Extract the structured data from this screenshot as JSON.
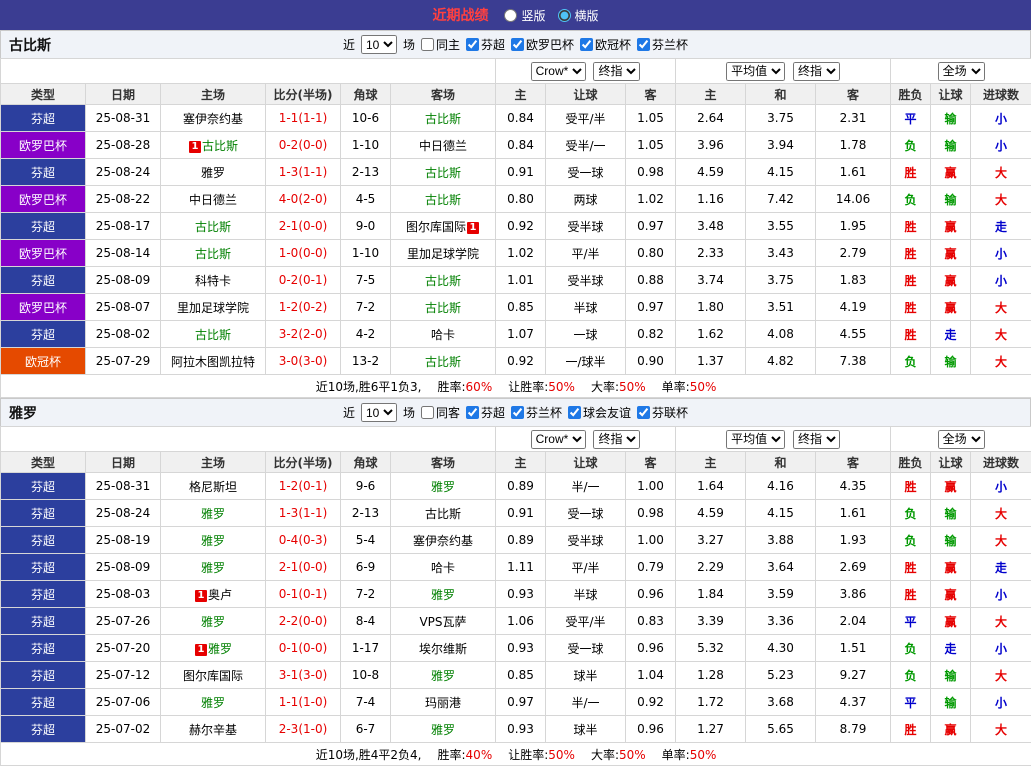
{
  "titlebar": {
    "title": "近期战绩",
    "options": [
      {
        "label": "竖版",
        "selected": false
      },
      {
        "label": "横版",
        "selected": true
      }
    ]
  },
  "colors": {
    "titlebar_bg": "#3b3d92",
    "title_text": "#ff4040",
    "focal_team": "#008000",
    "score_text": "#e60000",
    "badge_bg": "#e60000",
    "checkbox_accent": "#1e78e6",
    "summary_value": "#e60000",
    "result_red": "#e60000",
    "result_green": "#009900",
    "result_blue": "#0000cc"
  },
  "league_colors": {
    "芬超": "#2c3f9e",
    "欧罗巴杯": "#8800c8",
    "欧冠杯": "#e54a00"
  },
  "header": {
    "cols": [
      "类型",
      "日期",
      "主场",
      "比分(半场)",
      "角球",
      "客场",
      "主",
      "让球",
      "客",
      "主",
      "和",
      "客",
      "胜负",
      "让球",
      "进球数"
    ],
    "group1": {
      "select1": "Crow*",
      "select2": "终指"
    },
    "group2": {
      "select1": "平均值",
      "select2": "终指"
    },
    "group3": {
      "select1": "全场"
    }
  },
  "sections": [
    {
      "team": "古比斯",
      "filter": {
        "near_label": "近",
        "count": "10",
        "games_label": "场",
        "same_label": "同主",
        "leagues": [
          "芬超",
          "欧罗巴杯",
          "欧冠杯",
          "芬兰杯"
        ]
      },
      "rows": [
        {
          "league": "芬超",
          "date": "25-08-31",
          "home": {
            "name": "塞伊奈约基",
            "focal": false
          },
          "score": "1-1(1-1)",
          "corners": "10-6",
          "away": {
            "name": "古比斯",
            "focal": true
          },
          "ah": [
            "0.84",
            "受平/半",
            "1.05"
          ],
          "avg": [
            "2.64",
            "3.75",
            "2.31"
          ],
          "results": [
            "平",
            "输",
            "小"
          ]
        },
        {
          "league": "欧罗巴杯",
          "date": "25-08-28",
          "home": {
            "name": "古比斯",
            "focal": true,
            "badge": "1",
            "badge_pos": "pre"
          },
          "score": "0-2(0-0)",
          "corners": "1-10",
          "away": {
            "name": "中日德兰",
            "focal": false
          },
          "ah": [
            "0.84",
            "受半/一",
            "1.05"
          ],
          "avg": [
            "3.96",
            "3.94",
            "1.78"
          ],
          "results": [
            "负",
            "输",
            "小"
          ]
        },
        {
          "league": "芬超",
          "date": "25-08-24",
          "home": {
            "name": "雅罗",
            "focal": false
          },
          "score": "1-3(1-1)",
          "corners": "2-13",
          "away": {
            "name": "古比斯",
            "focal": true
          },
          "ah": [
            "0.91",
            "受一球",
            "0.98"
          ],
          "avg": [
            "4.59",
            "4.15",
            "1.61"
          ],
          "results": [
            "胜",
            "赢",
            "大"
          ]
        },
        {
          "league": "欧罗巴杯",
          "date": "25-08-22",
          "home": {
            "name": "中日德兰",
            "focal": false
          },
          "score": "4-0(2-0)",
          "corners": "4-5",
          "away": {
            "name": "古比斯",
            "focal": true
          },
          "ah": [
            "0.80",
            "两球",
            "1.02"
          ],
          "avg": [
            "1.16",
            "7.42",
            "14.06"
          ],
          "results": [
            "负",
            "输",
            "大"
          ]
        },
        {
          "league": "芬超",
          "date": "25-08-17",
          "home": {
            "name": "古比斯",
            "focal": true
          },
          "score": "2-1(0-0)",
          "corners": "9-0",
          "away": {
            "name": "图尔库国际",
            "focal": false,
            "badge": "1",
            "badge_pos": "post"
          },
          "ah": [
            "0.92",
            "受半球",
            "0.97"
          ],
          "avg": [
            "3.48",
            "3.55",
            "1.95"
          ],
          "results": [
            "胜",
            "赢",
            "走"
          ]
        },
        {
          "league": "欧罗巴杯",
          "date": "25-08-14",
          "home": {
            "name": "古比斯",
            "focal": true
          },
          "score": "1-0(0-0)",
          "corners": "1-10",
          "away": {
            "name": "里加足球学院",
            "focal": false
          },
          "ah": [
            "1.02",
            "平/半",
            "0.80"
          ],
          "avg": [
            "2.33",
            "3.43",
            "2.79"
          ],
          "results": [
            "胜",
            "赢",
            "小"
          ]
        },
        {
          "league": "芬超",
          "date": "25-08-09",
          "home": {
            "name": "科特卡",
            "focal": false
          },
          "score": "0-2(0-1)",
          "corners": "7-5",
          "away": {
            "name": "古比斯",
            "focal": true
          },
          "ah": [
            "1.01",
            "受半球",
            "0.88"
          ],
          "avg": [
            "3.74",
            "3.75",
            "1.83"
          ],
          "results": [
            "胜",
            "赢",
            "小"
          ]
        },
        {
          "league": "欧罗巴杯",
          "date": "25-08-07",
          "home": {
            "name": "里加足球学院",
            "focal": false
          },
          "score": "1-2(0-2)",
          "corners": "7-2",
          "away": {
            "name": "古比斯",
            "focal": true
          },
          "ah": [
            "0.85",
            "半球",
            "0.97"
          ],
          "avg": [
            "1.80",
            "3.51",
            "4.19"
          ],
          "results": [
            "胜",
            "赢",
            "大"
          ]
        },
        {
          "league": "芬超",
          "date": "25-08-02",
          "home": {
            "name": "古比斯",
            "focal": true
          },
          "score": "3-2(2-0)",
          "corners": "4-2",
          "away": {
            "name": "哈卡",
            "focal": false
          },
          "ah": [
            "1.07",
            "一球",
            "0.82"
          ],
          "avg": [
            "1.62",
            "4.08",
            "4.55"
          ],
          "results": [
            "胜",
            "走",
            "大"
          ]
        },
        {
          "league": "欧冠杯",
          "date": "25-07-29",
          "home": {
            "name": "阿拉木图凯拉特",
            "focal": false
          },
          "score": "3-0(3-0)",
          "corners": "13-2",
          "away": {
            "name": "古比斯",
            "focal": true
          },
          "ah": [
            "0.92",
            "一/球半",
            "0.90"
          ],
          "avg": [
            "1.37",
            "4.82",
            "7.38"
          ],
          "results": [
            "负",
            "输",
            "大"
          ]
        }
      ],
      "summary": {
        "prefix": "近10场,胜6平1负3,",
        "stats": [
          {
            "label": "胜率:",
            "value": "60%"
          },
          {
            "label": "让胜率:",
            "value": "50%"
          },
          {
            "label": "大率:",
            "value": "50%"
          },
          {
            "label": "单率:",
            "value": "50%"
          }
        ]
      }
    },
    {
      "team": "雅罗",
      "filter": {
        "near_label": "近",
        "count": "10",
        "games_label": "场",
        "same_label": "同客",
        "leagues": [
          "芬超",
          "芬兰杯",
          "球会友谊",
          "芬联杯"
        ]
      },
      "rows": [
        {
          "league": "芬超",
          "date": "25-08-31",
          "home": {
            "name": "格尼斯坦",
            "focal": false
          },
          "score": "1-2(0-1)",
          "corners": "9-6",
          "away": {
            "name": "雅罗",
            "focal": true
          },
          "ah": [
            "0.89",
            "半/一",
            "1.00"
          ],
          "avg": [
            "1.64",
            "4.16",
            "4.35"
          ],
          "results": [
            "胜",
            "赢",
            "小"
          ]
        },
        {
          "league": "芬超",
          "date": "25-08-24",
          "home": {
            "name": "雅罗",
            "focal": true
          },
          "score": "1-3(1-1)",
          "corners": "2-13",
          "away": {
            "name": "古比斯",
            "focal": false
          },
          "ah": [
            "0.91",
            "受一球",
            "0.98"
          ],
          "avg": [
            "4.59",
            "4.15",
            "1.61"
          ],
          "results": [
            "负",
            "输",
            "大"
          ]
        },
        {
          "league": "芬超",
          "date": "25-08-19",
          "home": {
            "name": "雅罗",
            "focal": true
          },
          "score": "0-4(0-3)",
          "corners": "5-4",
          "away": {
            "name": "塞伊奈约基",
            "focal": false
          },
          "ah": [
            "0.89",
            "受半球",
            "1.00"
          ],
          "avg": [
            "3.27",
            "3.88",
            "1.93"
          ],
          "results": [
            "负",
            "输",
            "大"
          ]
        },
        {
          "league": "芬超",
          "date": "25-08-09",
          "home": {
            "name": "雅罗",
            "focal": true
          },
          "score": "2-1(0-0)",
          "corners": "6-9",
          "away": {
            "name": "哈卡",
            "focal": false
          },
          "ah": [
            "1.11",
            "平/半",
            "0.79"
          ],
          "avg": [
            "2.29",
            "3.64",
            "2.69"
          ],
          "results": [
            "胜",
            "赢",
            "走"
          ]
        },
        {
          "league": "芬超",
          "date": "25-08-03",
          "home": {
            "name": "奥卢",
            "focal": false,
            "badge": "1",
            "badge_pos": "pre"
          },
          "score": "0-1(0-1)",
          "corners": "7-2",
          "away": {
            "name": "雅罗",
            "focal": true
          },
          "ah": [
            "0.93",
            "半球",
            "0.96"
          ],
          "avg": [
            "1.84",
            "3.59",
            "3.86"
          ],
          "results": [
            "胜",
            "赢",
            "小"
          ]
        },
        {
          "league": "芬超",
          "date": "25-07-26",
          "home": {
            "name": "雅罗",
            "focal": true
          },
          "score": "2-2(0-0)",
          "corners": "8-4",
          "away": {
            "name": "VPS瓦萨",
            "focal": false
          },
          "ah": [
            "1.06",
            "受平/半",
            "0.83"
          ],
          "avg": [
            "3.39",
            "3.36",
            "2.04"
          ],
          "results": [
            "平",
            "赢",
            "大"
          ]
        },
        {
          "league": "芬超",
          "date": "25-07-20",
          "home": {
            "name": "雅罗",
            "focal": true,
            "badge": "1",
            "badge_pos": "pre"
          },
          "score": "0-1(0-0)",
          "corners": "1-17",
          "away": {
            "name": "埃尔维斯",
            "focal": false
          },
          "ah": [
            "0.93",
            "受一球",
            "0.96"
          ],
          "avg": [
            "5.32",
            "4.30",
            "1.51"
          ],
          "results": [
            "负",
            "走",
            "小"
          ]
        },
        {
          "league": "芬超",
          "date": "25-07-12",
          "home": {
            "name": "图尔库国际",
            "focal": false
          },
          "score": "3-1(3-0)",
          "corners": "10-8",
          "away": {
            "name": "雅罗",
            "focal": true
          },
          "ah": [
            "0.85",
            "球半",
            "1.04"
          ],
          "avg": [
            "1.28",
            "5.23",
            "9.27"
          ],
          "results": [
            "负",
            "输",
            "大"
          ]
        },
        {
          "league": "芬超",
          "date": "25-07-06",
          "home": {
            "name": "雅罗",
            "focal": true
          },
          "score": "1-1(1-0)",
          "corners": "7-4",
          "away": {
            "name": "玛丽港",
            "focal": false
          },
          "ah": [
            "0.97",
            "半/一",
            "0.92"
          ],
          "avg": [
            "1.72",
            "3.68",
            "4.37"
          ],
          "results": [
            "平",
            "输",
            "小"
          ]
        },
        {
          "league": "芬超",
          "date": "25-07-02",
          "home": {
            "name": "赫尔辛基",
            "focal": false
          },
          "score": "2-3(1-0)",
          "corners": "6-7",
          "away": {
            "name": "雅罗",
            "focal": true
          },
          "ah": [
            "0.93",
            "球半",
            "0.96"
          ],
          "avg": [
            "1.27",
            "5.65",
            "8.79"
          ],
          "results": [
            "胜",
            "赢",
            "大"
          ]
        }
      ],
      "summary": {
        "prefix": "近10场,胜4平2负4,",
        "stats": [
          {
            "label": "胜率:",
            "value": "40%"
          },
          {
            "label": "让胜率:",
            "value": "50%"
          },
          {
            "label": "大率:",
            "value": "50%"
          },
          {
            "label": "单率:",
            "value": "50%"
          }
        ]
      }
    }
  ]
}
